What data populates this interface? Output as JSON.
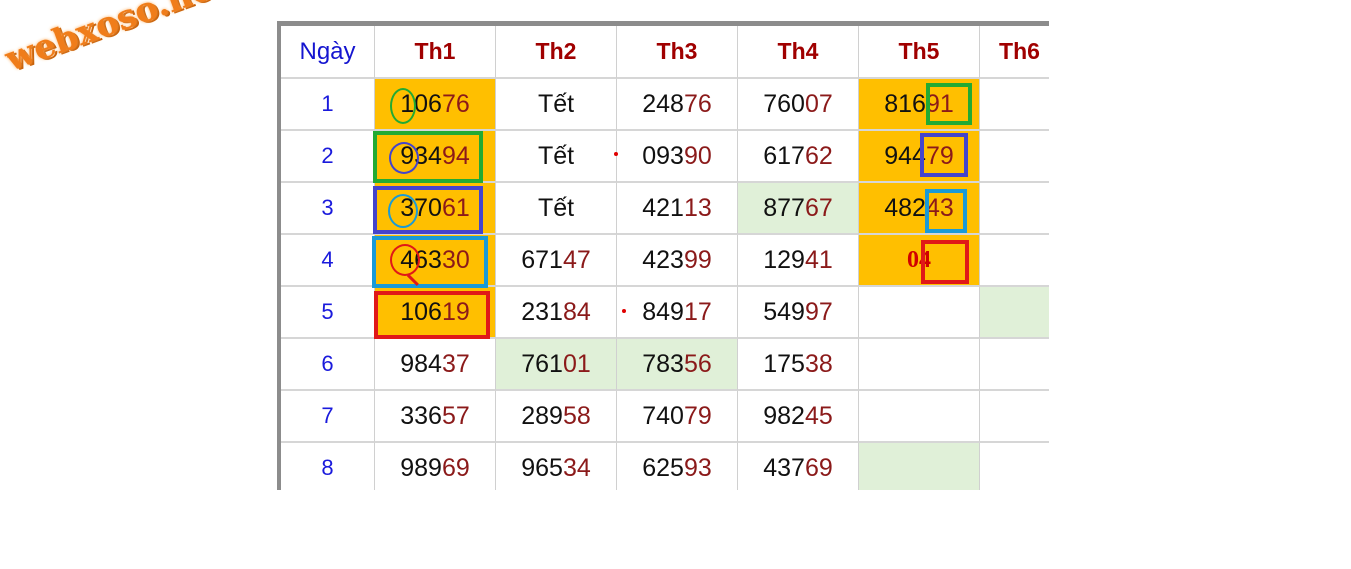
{
  "logo": {
    "text": "webxoso.net",
    "color": "#f07d1a"
  },
  "table": {
    "headers": [
      "Ngày",
      "Th1",
      "Th2",
      "Th3",
      "Th4",
      "Th5",
      "Th6"
    ],
    "rows": [
      {
        "day": "1",
        "cells": [
          {
            "pre": "106",
            "hi": "76"
          },
          {
            "pre": "Tết",
            "hi": ""
          },
          {
            "pre": "248",
            "hi": "76"
          },
          {
            "pre": "760",
            "hi": "07"
          },
          {
            "pre": "816",
            "hi": "91"
          },
          {
            "pre": "",
            "hi": ""
          }
        ]
      },
      {
        "day": "2",
        "cells": [
          {
            "pre": "934",
            "hi": "94"
          },
          {
            "pre": "Tết",
            "hi": ""
          },
          {
            "pre": "093",
            "hi": "90"
          },
          {
            "pre": "617",
            "hi": "62"
          },
          {
            "pre": "944",
            "hi": "79"
          },
          {
            "pre": "",
            "hi": ""
          }
        ]
      },
      {
        "day": "3",
        "cells": [
          {
            "pre": "370",
            "hi": "61"
          },
          {
            "pre": "Tết",
            "hi": ""
          },
          {
            "pre": "421",
            "hi": "13"
          },
          {
            "pre": "877",
            "hi": "67"
          },
          {
            "pre": "482",
            "hi": "43"
          },
          {
            "pre": "",
            "hi": ""
          }
        ]
      },
      {
        "day": "4",
        "cells": [
          {
            "pre": "463",
            "hi": "30"
          },
          {
            "pre": "671",
            "hi": "47"
          },
          {
            "pre": "423",
            "hi": "99"
          },
          {
            "pre": "129",
            "hi": "41"
          },
          {
            "pre": "",
            "hi": "04"
          },
          {
            "pre": "",
            "hi": ""
          }
        ]
      },
      {
        "day": "5",
        "cells": [
          {
            "pre": "106",
            "hi": "19"
          },
          {
            "pre": "231",
            "hi": "84"
          },
          {
            "pre": "849",
            "hi": "17"
          },
          {
            "pre": "549",
            "hi": "97"
          },
          {
            "pre": "",
            "hi": ""
          },
          {
            "pre": "",
            "hi": ""
          }
        ]
      },
      {
        "day": "6",
        "cells": [
          {
            "pre": "984",
            "hi": "37"
          },
          {
            "pre": "761",
            "hi": "01"
          },
          {
            "pre": "783",
            "hi": "56"
          },
          {
            "pre": "175",
            "hi": "38"
          },
          {
            "pre": "",
            "hi": ""
          },
          {
            "pre": "",
            "hi": ""
          }
        ]
      },
      {
        "day": "7",
        "cells": [
          {
            "pre": "336",
            "hi": "57"
          },
          {
            "pre": "289",
            "hi": "58"
          },
          {
            "pre": "740",
            "hi": "79"
          },
          {
            "pre": "982",
            "hi": "45"
          },
          {
            "pre": "",
            "hi": ""
          },
          {
            "pre": "",
            "hi": ""
          }
        ]
      },
      {
        "day": "8",
        "cells": [
          {
            "pre": "989",
            "hi": "69"
          },
          {
            "pre": "965",
            "hi": "34"
          },
          {
            "pre": "625",
            "hi": "93"
          },
          {
            "pre": "437",
            "hi": "69"
          },
          {
            "pre": "",
            "hi": ""
          },
          {
            "pre": "",
            "hi": ""
          }
        ]
      }
    ]
  },
  "colors": {
    "header_text": "#a00000",
    "day_text": "#1a1adc",
    "highlight_digits": "#8b1a1a",
    "yellow_cell": "#ffbf00",
    "green_cell": "#e0f0d8"
  }
}
